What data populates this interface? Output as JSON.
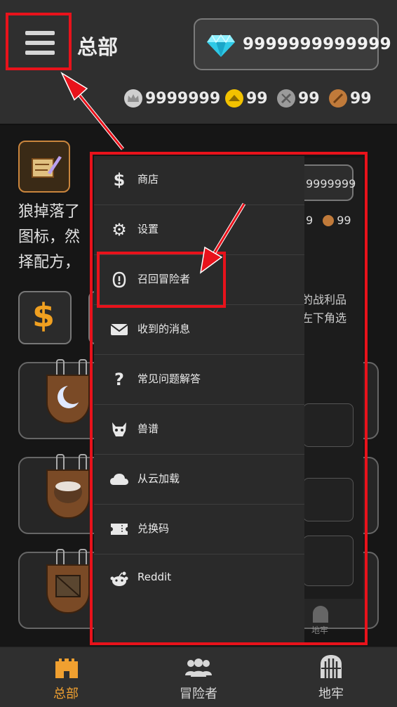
{
  "header": {
    "title": "总部",
    "gems": "9999999999999",
    "resources": [
      {
        "icon": "crown-coin-icon",
        "value": "9999999",
        "color": "#cfcfcf"
      },
      {
        "icon": "gold-coin-icon",
        "value": "99",
        "color": "#f2c200"
      },
      {
        "icon": "silver-coin-icon",
        "value": "99",
        "color": "#9a9a9a"
      },
      {
        "icon": "bronze-coin-icon",
        "value": "99",
        "color": "#c07a3a"
      }
    ]
  },
  "content": {
    "text_lines": [
      "狼掉落了",
      "图标，然",
      "择配方，"
    ]
  },
  "underlay": {
    "gems": "9999999",
    "res1": "9",
    "res2": "99",
    "loot_lines": [
      "的战利品",
      "左下角选"
    ],
    "nav_label": "地牢"
  },
  "drawer": {
    "items": [
      {
        "label": "商店",
        "icon": "dollar-icon"
      },
      {
        "label": "设置",
        "icon": "gear-icon"
      },
      {
        "label": "召回冒险者",
        "icon": "recall-icon"
      },
      {
        "label": "收到的消息",
        "icon": "mail-icon"
      },
      {
        "label": "常见问题解答",
        "icon": "question-icon"
      },
      {
        "label": "兽谱",
        "icon": "monster-icon"
      },
      {
        "label": "从云加载",
        "icon": "cloud-icon"
      },
      {
        "label": "兑换码",
        "icon": "ticket-icon"
      },
      {
        "label": "Reddit",
        "icon": "reddit-icon"
      }
    ]
  },
  "bottom_nav": {
    "items": [
      {
        "label": "总部",
        "icon": "castle-icon",
        "active": true
      },
      {
        "label": "冒险者",
        "icon": "people-icon",
        "active": false
      },
      {
        "label": "地牢",
        "icon": "dungeon-gate-icon",
        "active": false
      }
    ],
    "active_color": "#f0a030",
    "inactive_color": "#d8d8d8"
  },
  "annotation_color": "#e8121b"
}
